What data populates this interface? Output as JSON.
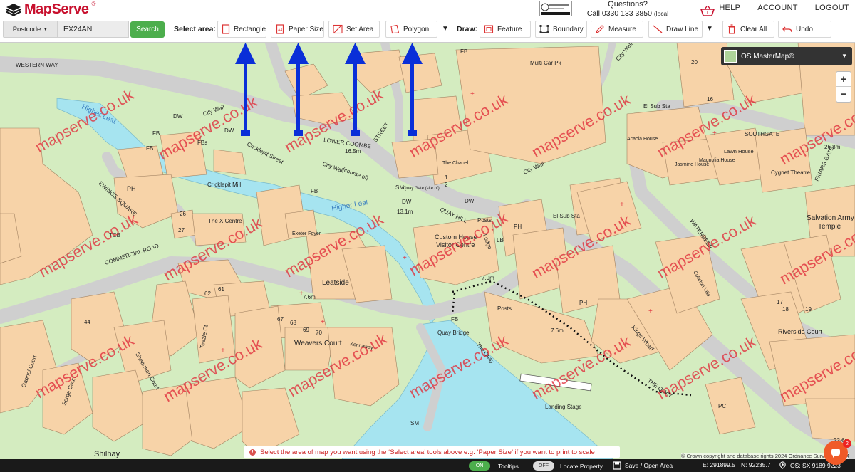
{
  "header": {
    "logo_text": "MapServe",
    "logo_reg": "®",
    "partner_badge": "Ordnance Survey Licensed Partner",
    "questions_title": "Questions?",
    "phone": "Call 0330 133 3850",
    "phone_note": "(local rate)",
    "nav": [
      "HELP",
      "ACCOUNT",
      "LOGOUT"
    ]
  },
  "toolbar": {
    "postcode_select": "Postcode",
    "postcode_value": "EX24AN",
    "search_label": "Search",
    "select_area_label": "Select area:",
    "select_tools": [
      "Rectangle",
      "Paper Size",
      "Set Area",
      "Polygon"
    ],
    "draw_label": "Draw:",
    "draw_tools": [
      "Feature",
      "Boundary",
      "Measure",
      "Draw Line",
      "Clear All",
      "Undo"
    ]
  },
  "map": {
    "layer": "OS MasterMap®",
    "zoom_in": "+",
    "zoom_out": "−",
    "watermark": "mapserve.co.uk",
    "labels": {
      "western_way": "WESTERN WAY",
      "higher_leat_1": "Higher Leat",
      "higher_leat_2": "Higher Leat",
      "fb1": "FB",
      "fb2": "FB",
      "fb3": "FB",
      "fb4": "FB",
      "fbs": "FBs",
      "dw1": "DW",
      "dw2": "DW",
      "dw3": "DW",
      "dw4": "DW",
      "city_wall_1": "City Wall",
      "city_wall_2": "City Wall",
      "city_wall_3": "City Wall",
      "city_wall_4": "City Wall",
      "course_of": "(course of)",
      "cricklepit_street": "Cricklepit Street",
      "cricklepit_mill": "Cricklepit Mill",
      "lower_coombe": "LOWER COOMBE",
      "coombe_street": "STREET",
      "ewings_square": "EWINGS SQUARE",
      "ph1": "PH",
      "ph2": "PH",
      "ph3": "PH",
      "ph4": "PH",
      "the_x_centre": "The X Centre",
      "exeter_foyer": "Exeter Foyer",
      "commercial_road": "COMMERCIAL ROAD",
      "tcb": "TCB",
      "leatside": "Leatside",
      "custom_house": "Custom House",
      "visitor_centre": "Visitor Centre",
      "quay_hill": "QUAY HILL",
      "the_chapel": "The Chapel",
      "multi_car_pk": "Multi Car Pk",
      "el_sub_sta_1": "El Sub Sta",
      "el_sub_sta_2": "El Sub Sta",
      "southgate": "SOUTHGATE",
      "acacia_house": "Acacia House",
      "magnolia_house": "Magnolia House",
      "jasmine_house": "Jasmine House",
      "lawn_house": "Lawn House",
      "cygnet_theatre": "Cygnet Theatre",
      "friars_gate": "FRIARS GATE",
      "salvation_army": "Salvation Army",
      "temple": "Temple",
      "waterbeer": "WATERBEER",
      "colleton_villa": "Colleton Villa",
      "posts1": "Posts",
      "posts2": "Posts",
      "quay_bridge": "Quay Bridge",
      "the_quay": "The Quay",
      "kings_wharf": "Kings Wharf",
      "the_quay_road": "THE QUAY",
      "landing_stage": "Landing Stage",
      "riverside_court": "Riverside Court",
      "weavers_court": "Weavers Court",
      "shearman_court": "Shearman Court",
      "serge_court": "Serge Court",
      "gabriel_court": "Gabriel Court",
      "teazle_ct": "Teazle Ct",
      "shilhay": "Shilhay",
      "kennaway": "Kennaway",
      "lodge": "Lodge",
      "lb": "LB",
      "pc": "PC",
      "sm1": "SM",
      "sm2": "SM",
      "h165": "16.5m",
      "h131": "13.1m",
      "h76": "7.6m",
      "h79": "7.9m",
      "h76b": "7.6m",
      "h268": "26.8m",
      "h226": "22.6m",
      "quay_gate": "Quay Gate (site of)",
      "n20": "20",
      "n16": "16",
      "n26": "26",
      "n27": "27",
      "n44": "44",
      "n62": "62",
      "n61": "61",
      "n67": "67",
      "n68": "68",
      "n69": "69",
      "n70": "70",
      "n1": "1",
      "n2": "2",
      "n17": "17",
      "n18": "18",
      "n19": "19"
    }
  },
  "message": {
    "icon": "!",
    "text": "Select the area of map you want using the ‘Select area’ tools above e.g. ‘Paper Size’ if you want to print to scale"
  },
  "copyright": "© Crown copyright and database rights 2024 Ordnance Survey 100034",
  "chat": {
    "badge": "2"
  },
  "status": {
    "tooltips_state": "ON",
    "tooltips_label": "Tooltips",
    "locate_state": "OFF",
    "locate_label": "Locate Property",
    "save_label": "Save / Open Area",
    "easting": "E: 291899.5",
    "northing": "N: 92235.7",
    "grid_ref": "OS: SX 9189 9223"
  },
  "colors": {
    "building": "#f7d3a8",
    "road": "#d4d4d4",
    "grass": "#d4ecc0",
    "water": "#a6e4f0",
    "watermark": "#e0303c",
    "arrow": "#0a2fd8",
    "accent_red": "#c8102e",
    "search_green": "#4cae4c"
  }
}
